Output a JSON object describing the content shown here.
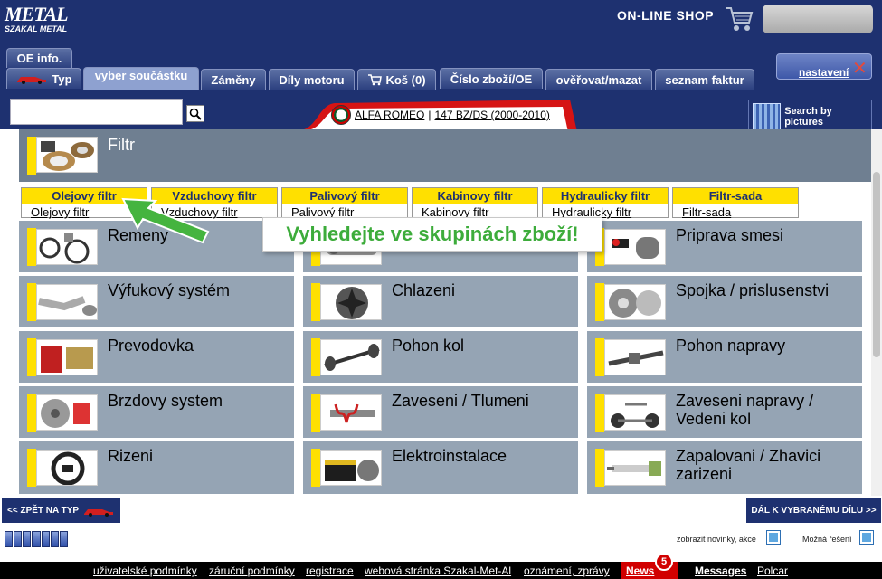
{
  "header": {
    "logo_top": "METAL",
    "logo_bottom": "SZAKAL METAL",
    "shop_label": "ON-LINE SHOP",
    "settings_label": "nastavení"
  },
  "tabs": {
    "oe_info": "OE info.",
    "typ": "Typ",
    "vyber": "vyber součástku",
    "zameny": "Záměny",
    "dily_motoru": "Díly motoru",
    "kos": "Koš (0)",
    "cislo": "Číslo zboží/OE",
    "overovat": "ověřovat/mazat",
    "faktury": "seznam faktur"
  },
  "search": {
    "value": "",
    "placeholder": ""
  },
  "vehicle": {
    "make": "ALFA ROMEO",
    "separator": "|",
    "model": "147 BZ/DS (2000-2010)"
  },
  "search_by_pictures": "Search by pictures",
  "category_open": {
    "label": "Filtr",
    "subgroups": [
      {
        "header": "Olejovy filtr",
        "link": "Olejovy filtr"
      },
      {
        "header": "Vzduchovy filtr",
        "link": "Vzduchovy filtr"
      },
      {
        "header": "Palivový filtr",
        "link": "Palivový filtr"
      },
      {
        "header": "Kabinovy filtr",
        "link": "Kabinovy filtr"
      },
      {
        "header": "Hydraulicky filtr",
        "link": "Hydraulicky filtr"
      },
      {
        "header": "Filtr-sada",
        "link": "Filtr-sada"
      }
    ]
  },
  "callout": "Vyhledejte ve skupinách zboží!",
  "categories": [
    {
      "label": "Remeny"
    },
    {
      "label": ""
    },
    {
      "label": "Priprava smesi"
    },
    {
      "label": "Výfukový systém"
    },
    {
      "label": "Chlazeni"
    },
    {
      "label": "Spojka / prislusenstvi"
    },
    {
      "label": "Prevodovka"
    },
    {
      "label": "Pohon kol"
    },
    {
      "label": "Pohon napravy"
    },
    {
      "label": "Brzdovy system"
    },
    {
      "label": "Zaveseni / Tlumeni"
    },
    {
      "label": "Zaveseni napravy /",
      "label2": "Vedeni kol"
    },
    {
      "label": "Rizeni"
    },
    {
      "label": "Elektroinstalace"
    },
    {
      "label": "Zapalovani / Zhavici",
      "label2": "zarizeni"
    }
  ],
  "nav": {
    "back": "<< ZPĚT NA TYP",
    "next": "DÁL K VYBRANÉMU DÍLU >>"
  },
  "options": {
    "news": "zobrazit novinky, akce",
    "solutions": "Možná řešení"
  },
  "footer": {
    "links": [
      "uživatelské podmínky",
      "záruční podmínky",
      "registrace",
      "webová stránka Szakal-Met-Al",
      "oznámení, zprávy"
    ],
    "news": "News",
    "news_count": "5",
    "messages": "Messages",
    "polcar": "Polcar"
  },
  "colors": {
    "navy": "#1e3170",
    "tile": "#95a4b4",
    "accent_yellow": "#ffe000",
    "callout_green": "#3dac3b",
    "news_red": "#d10000"
  }
}
